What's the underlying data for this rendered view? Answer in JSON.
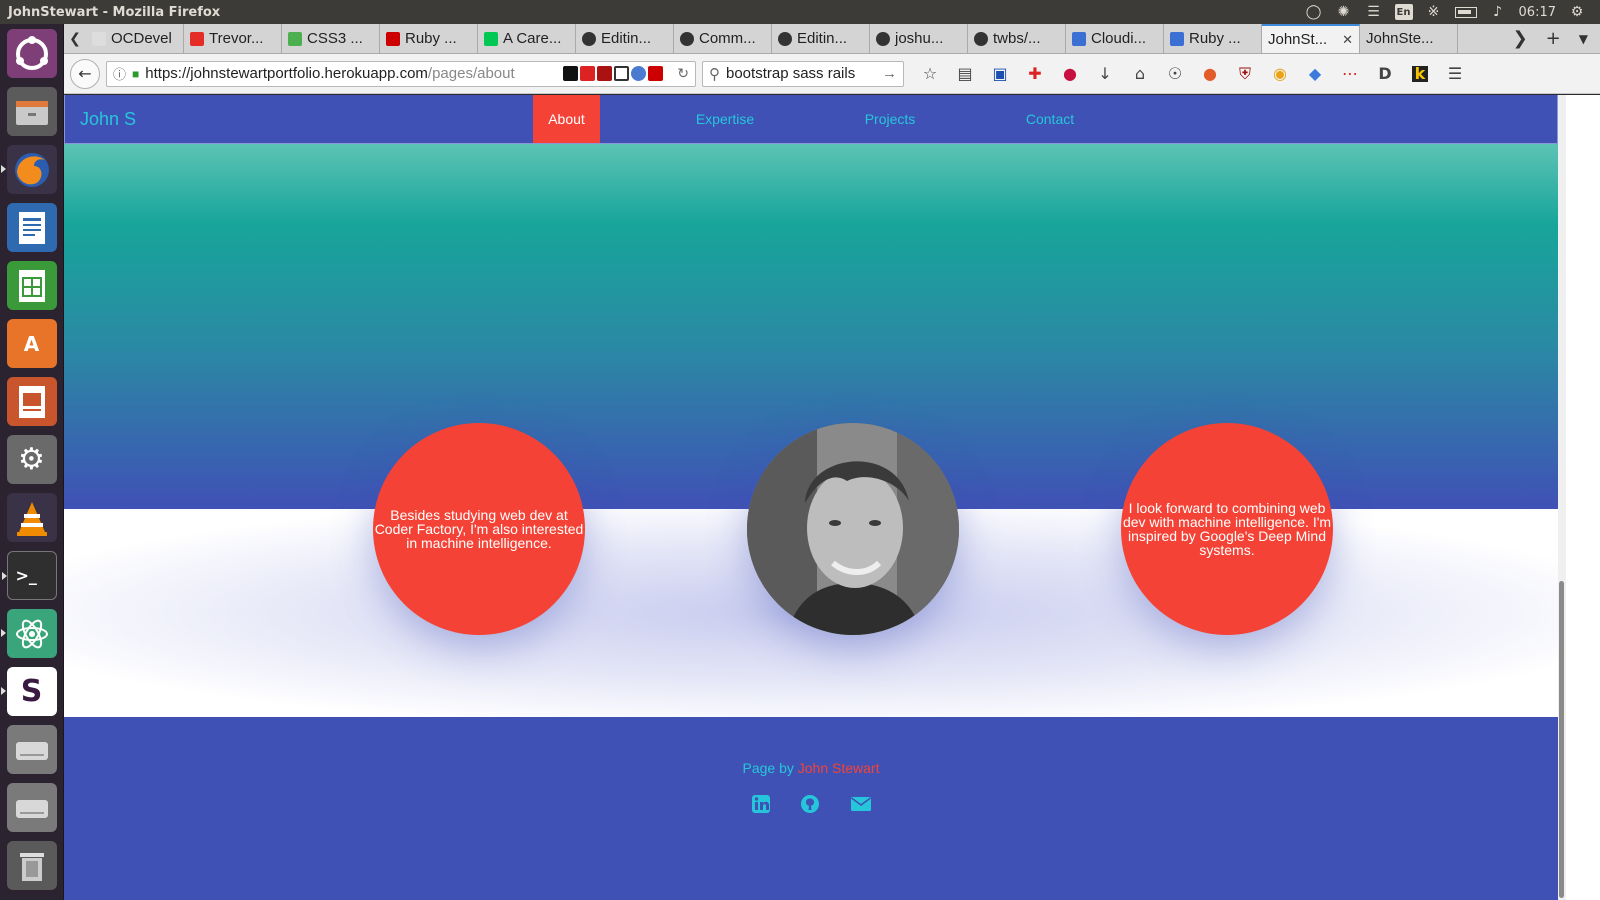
{
  "os_panel": {
    "window_title": "JohnStewart - Mozilla Firefox",
    "keyboard_layout": "En",
    "clock": "06:17"
  },
  "launcher": {
    "items": [
      {
        "name": "ubuntu-dash-icon"
      },
      {
        "name": "files-icon"
      },
      {
        "name": "firefox-icon"
      },
      {
        "name": "libreoffice-writer-icon"
      },
      {
        "name": "libreoffice-calc-icon"
      },
      {
        "name": "ubuntu-software-icon"
      },
      {
        "name": "libreoffice-impress-icon"
      },
      {
        "name": "system-settings-icon"
      },
      {
        "name": "vlc-icon"
      },
      {
        "name": "terminal-icon"
      },
      {
        "name": "atom-icon"
      },
      {
        "name": "slack-icon"
      },
      {
        "name": "drive-icon"
      },
      {
        "name": "drive-icon"
      },
      {
        "name": "trash-icon"
      }
    ]
  },
  "browser": {
    "tabs": [
      {
        "label": "OCDevel",
        "color": "#dddddd"
      },
      {
        "label": "Trevor...",
        "color": "#e52d27"
      },
      {
        "label": "CSS3 ...",
        "color": "#4caf50"
      },
      {
        "label": "Ruby ...",
        "color": "#cc0000"
      },
      {
        "label": "A Care...",
        "color": "#00c853"
      },
      {
        "label": "Editin...",
        "color": "#333333"
      },
      {
        "label": "Comm...",
        "color": "#333333"
      },
      {
        "label": "Editin...",
        "color": "#333333"
      },
      {
        "label": "joshu...",
        "color": "#333333"
      },
      {
        "label": "twbs/...",
        "color": "#333333"
      },
      {
        "label": "Cloudi...",
        "color": "#3b6fd4"
      },
      {
        "label": "Ruby ...",
        "color": "#3b6fd4"
      },
      {
        "label": "JohnSt...",
        "color": "",
        "active": true
      },
      {
        "label": "JohnSte...",
        "color": ""
      }
    ],
    "url": {
      "scheme_host": "https://johnstewartportfolio.herokuapp.com",
      "path": "/pages/about"
    },
    "search_value": "bootstrap sass rails"
  },
  "site": {
    "brand": "John S",
    "nav": [
      {
        "label": "About",
        "active": true
      },
      {
        "label": "Expertise",
        "active": false
      },
      {
        "label": "Projects",
        "active": false
      },
      {
        "label": "Contact",
        "active": false
      }
    ],
    "about": {
      "left_text": "Besides studying web dev at Coder Factory, I'm also interested in machine intelligence.",
      "right_text": "I look forward to combining web dev with machine intelligence. I'm inspired by Google's Deep Mind systems."
    },
    "footer": {
      "credit_prefix": "Page by",
      "credit_author": "John Stewart",
      "social": [
        "linkedin-icon",
        "github-icon",
        "email-icon"
      ]
    },
    "colors": {
      "primary": "#3f51b5",
      "accent": "#f44336",
      "teal": "#26c6da"
    }
  }
}
